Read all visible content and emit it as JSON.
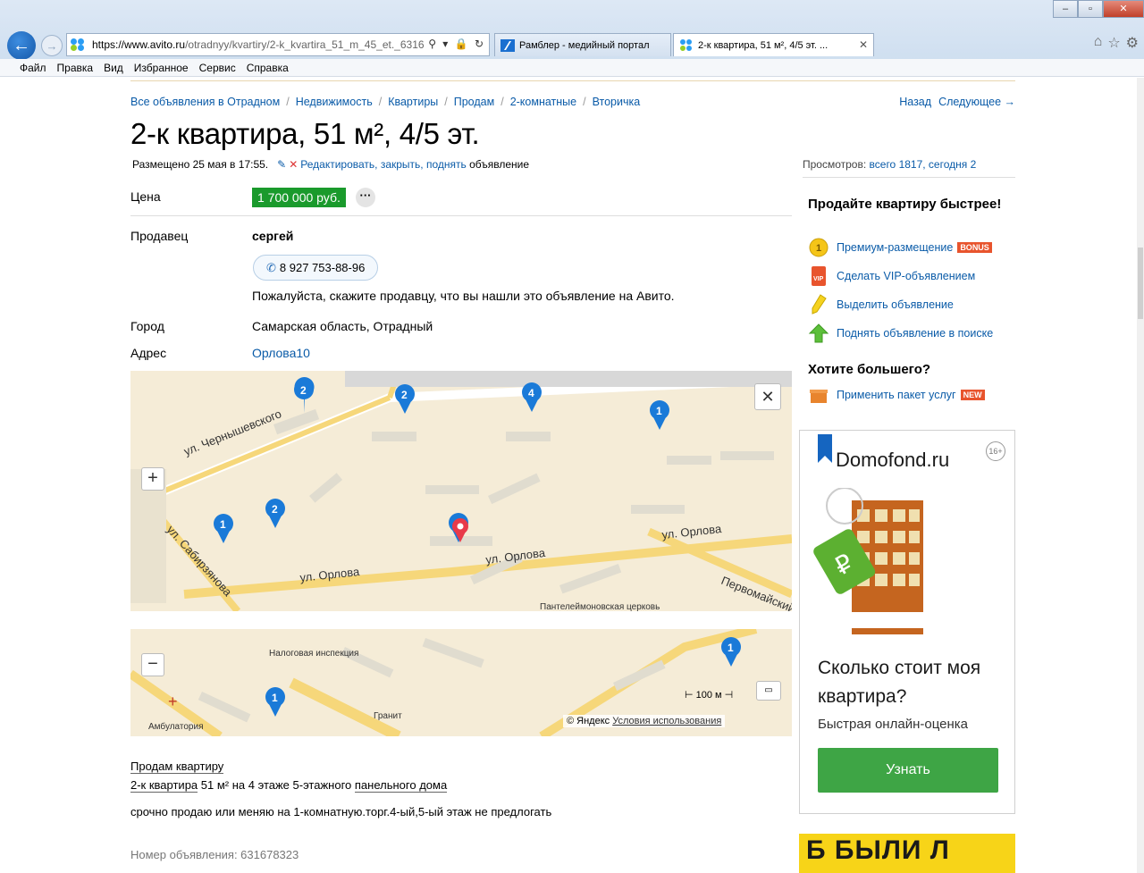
{
  "browser": {
    "url_prefix": "https://",
    "url_host": "www.avito.ru",
    "url_path": "/otradnyy/kvartiry/2-k_kvartira_51_m_45_et._6316",
    "tabs": [
      {
        "label": "Рамблер - медийный портал"
      },
      {
        "label": "2-к квартира, 51 м², 4/5 эт. ..."
      }
    ],
    "menu": [
      "Файл",
      "Правка",
      "Вид",
      "Избранное",
      "Сервис",
      "Справка"
    ]
  },
  "breadcrumb": [
    "Все объявления в Отрадном",
    "Недвижимость",
    "Квартиры",
    "Продам",
    "2-комнатные",
    "Вторичка"
  ],
  "nav": {
    "back": "Назад",
    "next": "Следующее →"
  },
  "listing": {
    "title": "2-к квартира, 51 м², 4/5 эт.",
    "posted": "Размещено 25 мая в 17:55.",
    "edit_link": "Редактировать, закрыть, поднять",
    "edit_suffix": "объявление",
    "views_label": "Просмотров:",
    "views_value": "всего 1817, сегодня 2"
  },
  "details": {
    "price_label": "Цена",
    "price": "1 700 000 руб.",
    "price_more": "···",
    "seller_label": "Продавец",
    "seller_name": "сергей",
    "phone": "8 927 753-88-96",
    "seller_note": "Пожалуйста, скажите продавцу, что вы нашли это объявление на Авито.",
    "city_label": "Город",
    "city": "Самарская область, Отрадный",
    "address_label": "Адрес",
    "address": "Орлова10"
  },
  "map": {
    "streets": [
      "ул. Чернышевского",
      "ул. Орлова",
      "ул. Орлова",
      "ул. Орлова",
      "ул. Сабирзянова",
      "Первомайский пр."
    ],
    "pois": [
      "Пантелеймоновская церковь",
      "Налоговая инспекция",
      "Амбулатория",
      "Гранит"
    ],
    "scale": "100 м",
    "credit": "© Яндекс",
    "terms": "Условия использования"
  },
  "description": {
    "heading": "Продам квартиру",
    "type_link": "2-к квартира",
    "type_mid": "51 м² на 4 этаже 5-этажного",
    "house_link": "панельного дома",
    "text": "срочно продаю или меняю на 1-комнатную.торг.4-ый,5-ый этаж не предлогать",
    "ad_number": "Номер объявления: 631678323"
  },
  "sidebar": {
    "sell_title": "Продайте квартиру быстрее!",
    "services": [
      {
        "label": "Премиум-размещение",
        "badge": "BONUS",
        "icon": "coin-icon"
      },
      {
        "label": "Сделать VIP-объявлением",
        "icon": "vip-icon"
      },
      {
        "label": "Выделить объявление",
        "icon": "highlighter-icon"
      },
      {
        "label": "Поднять объявление в поиске",
        "icon": "arrow-up-icon"
      }
    ],
    "more_title": "Хотите большего?",
    "package": {
      "label": "Применить пакет услуг",
      "badge": "NEW",
      "icon": "package-icon"
    }
  },
  "ad": {
    "brand": "Domofond.ru",
    "age": "16+",
    "question": "Сколько стоит моя квартира?",
    "subtitle": "Быстрая онлайн-оценка",
    "button": "Узнать",
    "banner2": "Б БЫЛИ Л"
  },
  "colors": {
    "link": "#0a5ba8",
    "price_bg": "#1a9a2c",
    "ad_button": "#3ea545",
    "badge": "#e8542d",
    "pin": "#1a7ad8",
    "pin_active": "#e83a4a"
  }
}
